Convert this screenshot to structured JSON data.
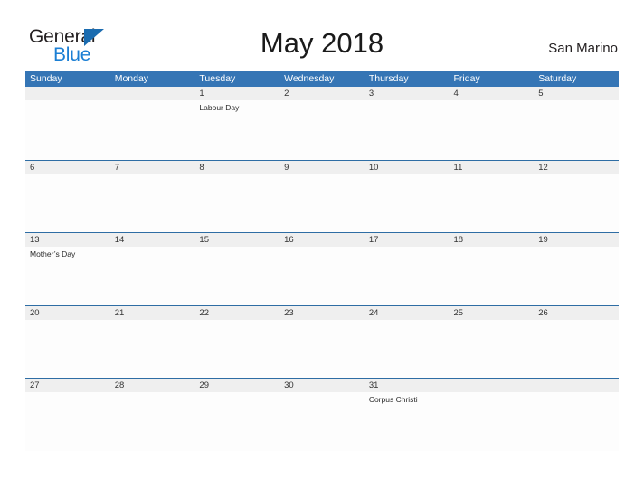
{
  "header": {
    "logo": {
      "word_general": "General",
      "word_blue": "Blue",
      "triangle_color": "#1b6cb0",
      "general_color": "#231f20",
      "blue_color": "#1b7fd4"
    },
    "title": "May 2018",
    "location": "San Marino"
  },
  "theme": {
    "header_blue": "#3575b5",
    "row_divider_blue": "#2e6da4",
    "number_band_gray": "#efefef",
    "page_background": "#ffffff",
    "text_dark": "#231f20"
  },
  "calendar": {
    "month": "May",
    "year": "2018",
    "weekday_headers": [
      "Sunday",
      "Monday",
      "Tuesday",
      "Wednesday",
      "Thursday",
      "Friday",
      "Saturday"
    ],
    "weeks": [
      {
        "days": [
          {
            "number": "",
            "event": ""
          },
          {
            "number": "",
            "event": ""
          },
          {
            "number": "1",
            "event": "Labour Day"
          },
          {
            "number": "2",
            "event": ""
          },
          {
            "number": "3",
            "event": ""
          },
          {
            "number": "4",
            "event": ""
          },
          {
            "number": "5",
            "event": ""
          }
        ]
      },
      {
        "days": [
          {
            "number": "6",
            "event": ""
          },
          {
            "number": "7",
            "event": ""
          },
          {
            "number": "8",
            "event": ""
          },
          {
            "number": "9",
            "event": ""
          },
          {
            "number": "10",
            "event": ""
          },
          {
            "number": "11",
            "event": ""
          },
          {
            "number": "12",
            "event": ""
          }
        ]
      },
      {
        "days": [
          {
            "number": "13",
            "event": "Mother’s Day"
          },
          {
            "number": "14",
            "event": ""
          },
          {
            "number": "15",
            "event": ""
          },
          {
            "number": "16",
            "event": ""
          },
          {
            "number": "17",
            "event": ""
          },
          {
            "number": "18",
            "event": ""
          },
          {
            "number": "19",
            "event": ""
          }
        ]
      },
      {
        "days": [
          {
            "number": "20",
            "event": ""
          },
          {
            "number": "21",
            "event": ""
          },
          {
            "number": "22",
            "event": ""
          },
          {
            "number": "23",
            "event": ""
          },
          {
            "number": "24",
            "event": ""
          },
          {
            "number": "25",
            "event": ""
          },
          {
            "number": "26",
            "event": ""
          }
        ]
      },
      {
        "days": [
          {
            "number": "27",
            "event": ""
          },
          {
            "number": "28",
            "event": ""
          },
          {
            "number": "29",
            "event": ""
          },
          {
            "number": "30",
            "event": ""
          },
          {
            "number": "31",
            "event": "Corpus Christi"
          },
          {
            "number": "",
            "event": ""
          },
          {
            "number": "",
            "event": ""
          }
        ]
      }
    ]
  }
}
